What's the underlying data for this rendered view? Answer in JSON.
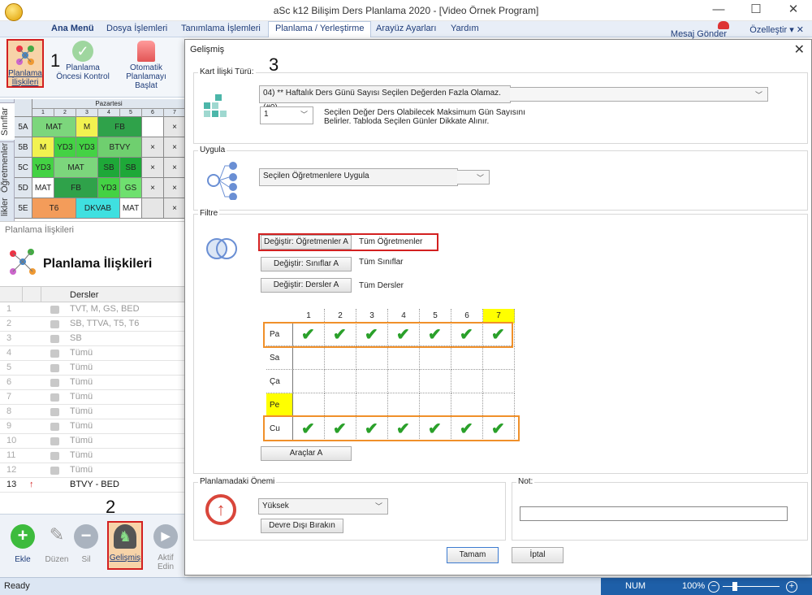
{
  "window": {
    "title": "aSc k12 Bilişim Ders Planlama 2020  - [Video Örnek Program]",
    "minimize": "—",
    "maximize": "☐",
    "close": "✕"
  },
  "menu": {
    "items": [
      "Ana Menü",
      "Dosya İşlemleri",
      "Tanımlama İşlemleri",
      "Planlama / Yerleştirme",
      "Arayüz Ayarları",
      "Yardım"
    ],
    "mesaj": "Mesaj Gönder",
    "ozellestir": "Özelleştir ▾ ✕"
  },
  "ribbon": {
    "buttons": [
      "Planlama İlişkileri",
      "Planlama Öncesi Kontrol",
      "Otomatik Planlamayı Başlat"
    ],
    "marker1": "1"
  },
  "grid": {
    "vtabs": [
      "Sınıflar",
      "Öğretmenler",
      "likler"
    ],
    "day_header": "Pazartesi",
    "periods": [
      "1",
      "2",
      "3",
      "4",
      "5",
      "6",
      "7"
    ],
    "rows": [
      {
        "cls": "5A",
        "cells": [
          "MAT",
          "M",
          "FB",
          "",
          "×",
          "×"
        ]
      },
      {
        "cls": "5B",
        "cells": [
          "M",
          "YD3",
          "YD3",
          "BTVY",
          "×",
          "×"
        ]
      },
      {
        "cls": "5C",
        "cells": [
          "YD3",
          "MAT",
          "SB",
          "SB",
          "×",
          "×"
        ]
      },
      {
        "cls": "5D",
        "cells": [
          "MAT",
          "FB",
          "YD3",
          "GS",
          "×",
          "×"
        ]
      },
      {
        "cls": "5E",
        "cells": [
          "T6",
          "DKVAB",
          "MAT",
          "",
          "×",
          "×"
        ]
      }
    ]
  },
  "planlama_panel": {
    "strip": "Planlama İlişkileri",
    "title": "Planlama İlişkileri",
    "col_header": "Dersler",
    "rows": [
      {
        "n": "1",
        "t": "TVT, M, GS, BED"
      },
      {
        "n": "2",
        "t": "SB, TTVA, T5, T6"
      },
      {
        "n": "3",
        "t": "SB"
      },
      {
        "n": "4",
        "t": "Tümü"
      },
      {
        "n": "5",
        "t": "Tümü"
      },
      {
        "n": "6",
        "t": "Tümü"
      },
      {
        "n": "7",
        "t": "Tümü"
      },
      {
        "n": "8",
        "t": "Tümü"
      },
      {
        "n": "9",
        "t": "Tümü"
      },
      {
        "n": "10",
        "t": "Tümü"
      },
      {
        "n": "11",
        "t": "Tümü"
      },
      {
        "n": "12",
        "t": "Tümü"
      },
      {
        "n": "13",
        "t": "BTVY - BED"
      }
    ]
  },
  "bottom_toolbar": {
    "buttons": [
      "Ekle",
      "Düzen",
      "Sil",
      "Gelişmiş",
      "Aktif Edin"
    ],
    "marker2": "2"
  },
  "status": {
    "ready": "Ready",
    "num": "NUM",
    "zoom": "100%"
  },
  "dialog": {
    "title": "Gelişmiş",
    "close": "✕",
    "marker3": "3",
    "kart": {
      "label": "Kart İlişki Türü:",
      "type_value": "04) ** Haftalık Ders Günü Sayısı Seçilen Değerden Fazla Olamaz. (#0)",
      "count_value": "1",
      "desc": "Seçilen Değer Ders Olabilecek Maksimum Gün Sayısını Belirler. Tabloda Seçilen Günler Dikkate Alınır."
    },
    "uygula": {
      "label": "Uygula",
      "value": "Seçilen Öğretmenlere Uygula"
    },
    "filtre": {
      "label": "Filtre",
      "teachers_btn": "Değiştir: Öğretmenler A",
      "teachers_val": "Tüm Öğretmenler",
      "classes_btn": "Değiştir: Sınıflar A",
      "classes_val": "Tüm Sınıflar",
      "subjects_btn": "Değiştir: Dersler A",
      "subjects_val": "Tüm Dersler"
    },
    "days": {
      "periods": [
        "1",
        "2",
        "3",
        "4",
        "5",
        "6",
        "7"
      ],
      "rows": [
        "Pa",
        "Sa",
        "Ça",
        "Pe",
        "Cu"
      ],
      "checked_rows": [
        "Pa",
        "Cu"
      ],
      "check": "✔",
      "tools_btn": "Araçlar A"
    },
    "onem": {
      "label": "Planlamadaki Önemi",
      "value": "Yüksek",
      "disable_btn": "Devre Dışı Bırakın"
    },
    "not": {
      "label": "Not:",
      "value": ""
    },
    "ok": "Tamam",
    "cancel": "İptal"
  }
}
